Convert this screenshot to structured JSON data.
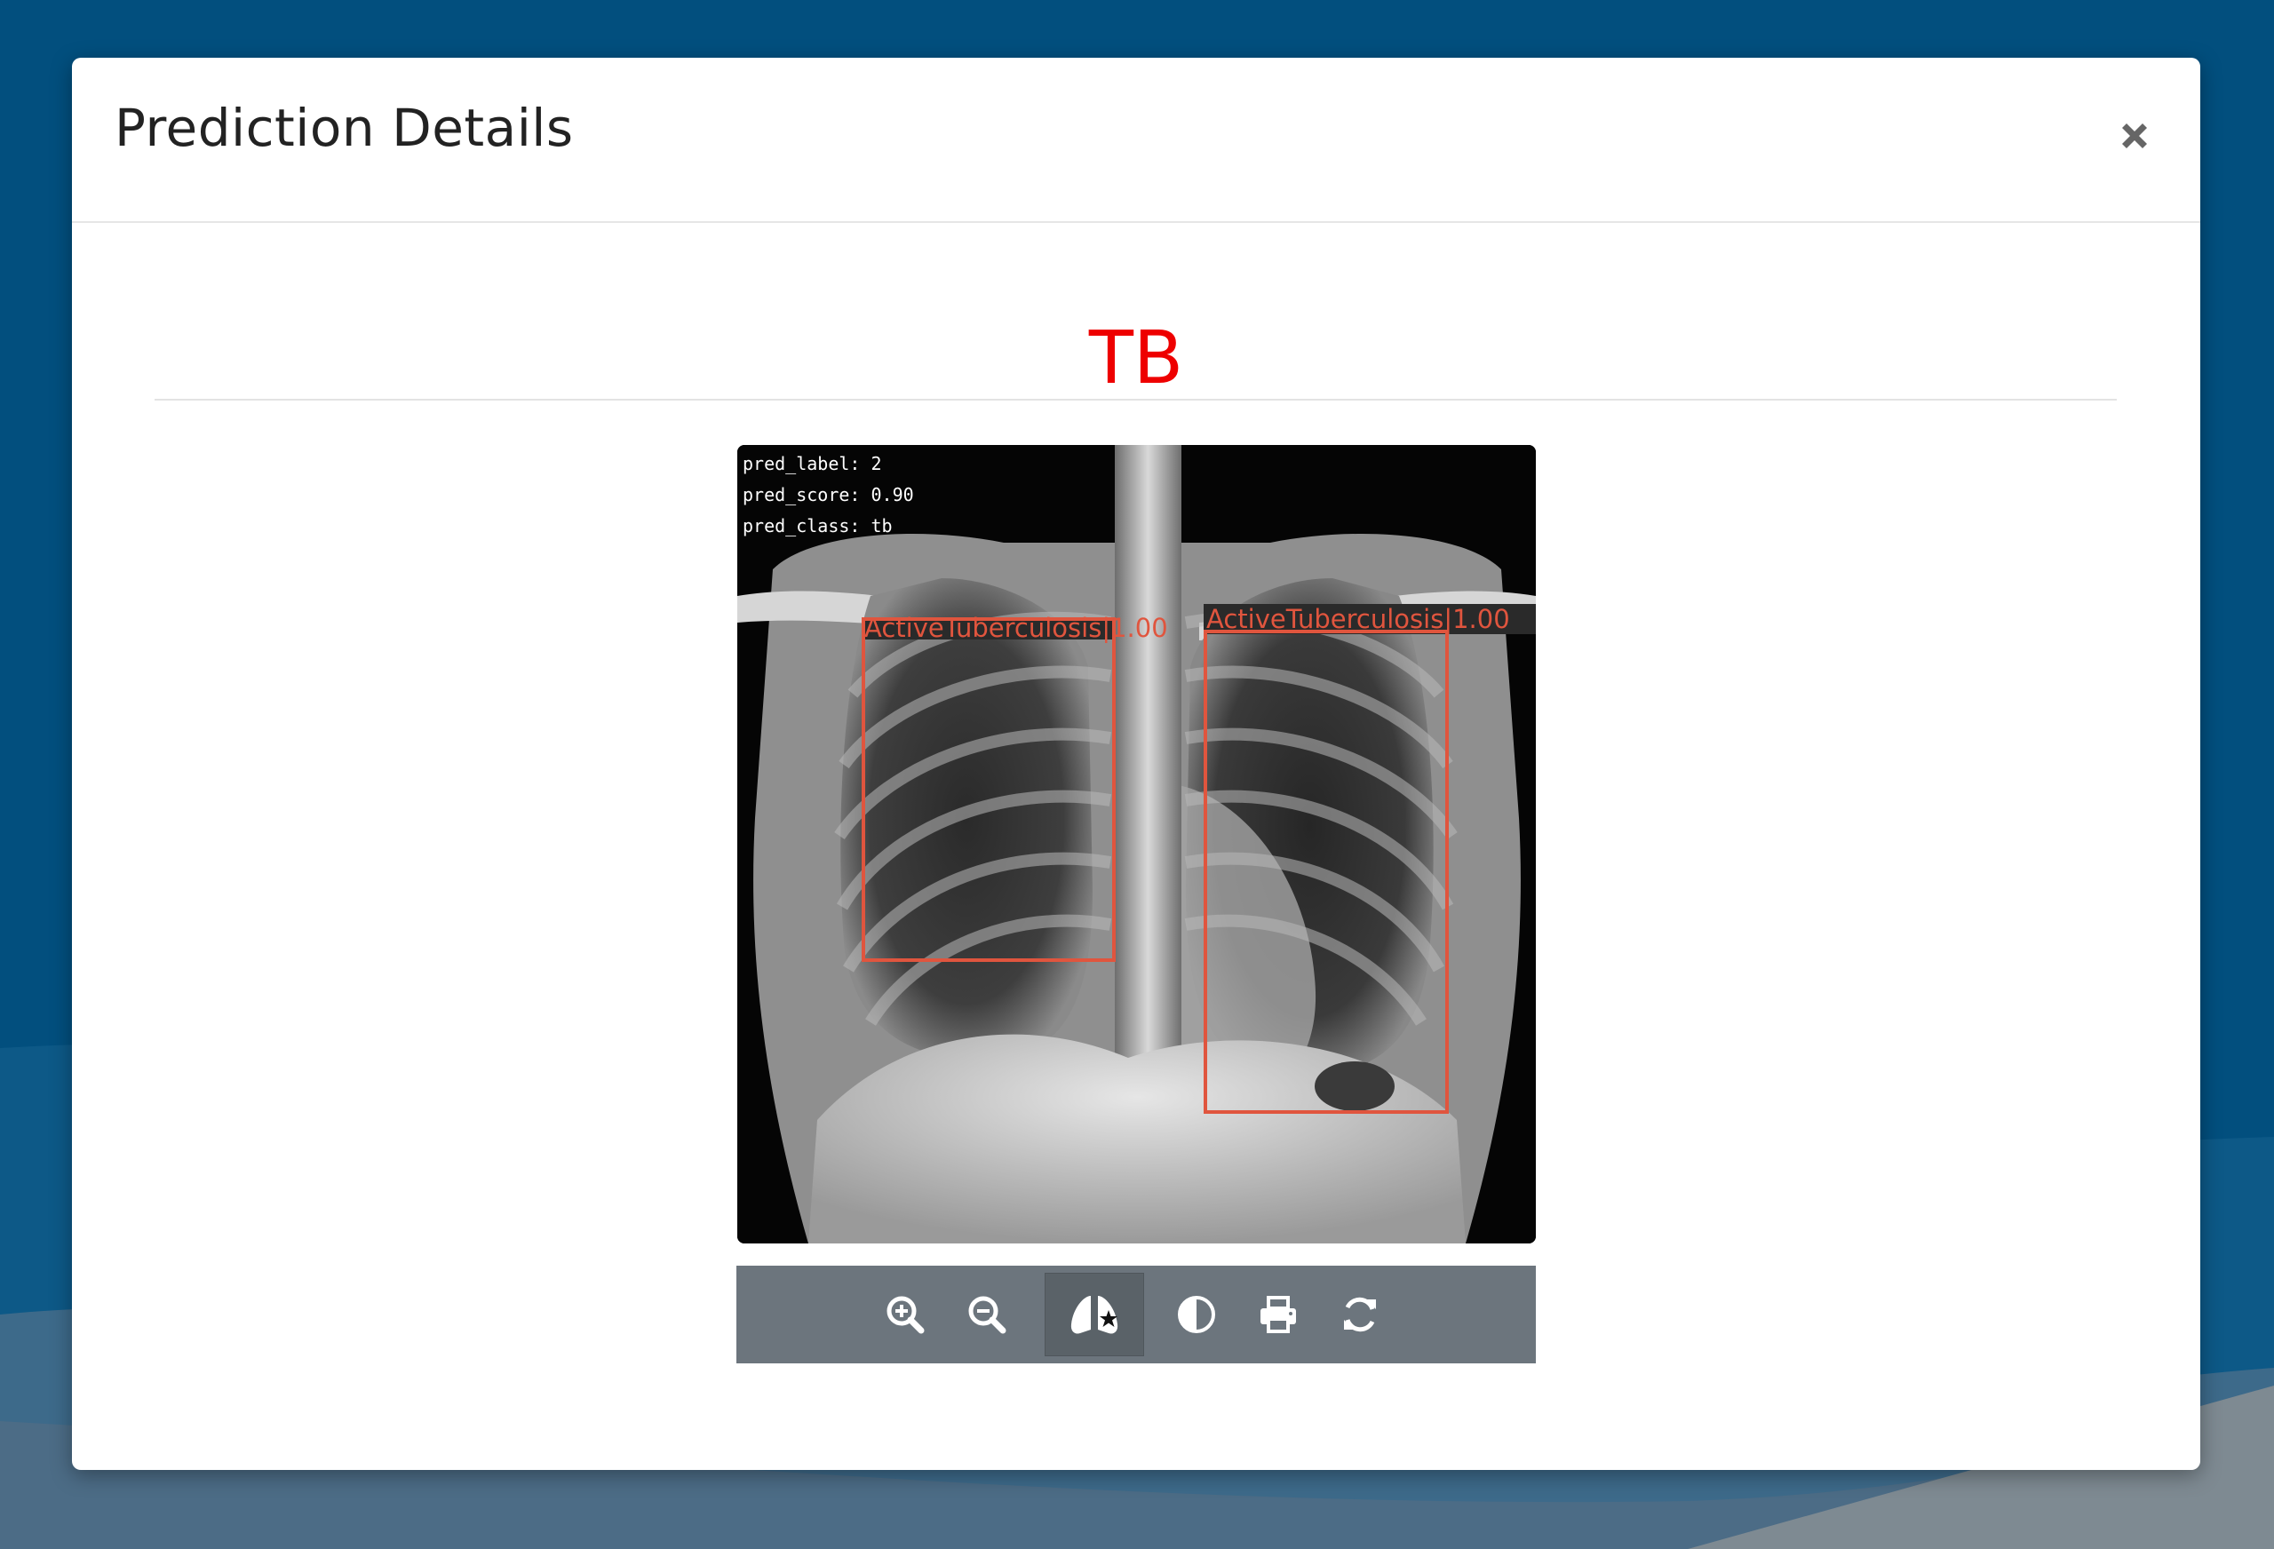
{
  "modal": {
    "title": "Prediction Details"
  },
  "result": {
    "label": "TB",
    "color": "#ee0000"
  },
  "image_overlay": {
    "pred_label": "pred_label: 2",
    "pred_score": "pred_score: 0.90",
    "pred_class": "pred_class: tb",
    "detections": [
      {
        "label": "ActiveTuberculosis|1.00"
      },
      {
        "label": "ActiveTuberculosis|1.00"
      }
    ],
    "box_color": "#e0553e"
  },
  "toolbar": {
    "buttons": [
      {
        "icon": "zoom-in-icon",
        "active": false
      },
      {
        "icon": "zoom-out-icon",
        "active": false
      },
      {
        "icon": "lungs-icon",
        "active": true
      },
      {
        "icon": "contrast-icon",
        "active": false
      },
      {
        "icon": "print-icon",
        "active": false
      },
      {
        "icon": "refresh-icon",
        "active": false
      }
    ]
  },
  "colors": {
    "backdrop": "#024f7e",
    "toolbar": "#6c757d",
    "toolbar_active": "#5a6268"
  }
}
